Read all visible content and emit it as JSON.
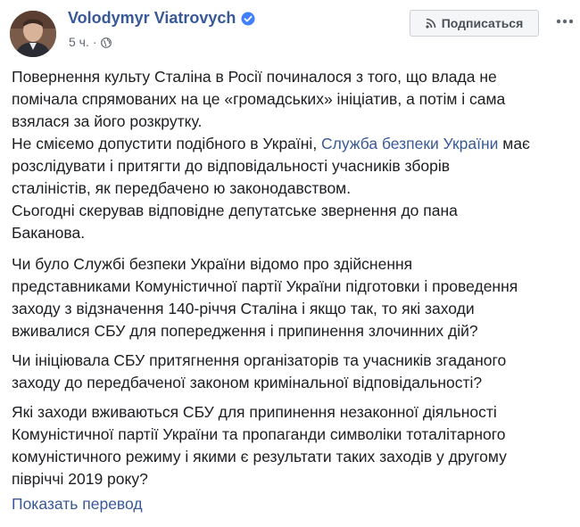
{
  "author": {
    "name": "Volodymyr Viatrovych",
    "verified": true
  },
  "meta": {
    "time": "5 ч.",
    "separator": "·",
    "privacy_icon": "globe-icon"
  },
  "actions": {
    "subscribe_label": "Подписаться",
    "subscribe_icon": "rss-icon",
    "more_icon": "more-icon"
  },
  "post": {
    "p1_line1": "Повернення культу Сталіна в Росії починалося з того, що влада не",
    "p1_line2": "помічала спрямованих на це «громадських» ініціатив, а потім і сама",
    "p1_line3": "взялася за його розкрутку.",
    "p1_line4": "Не смієемо допустити подібного в Україні, ",
    "p1_link": "Служба безпеки України",
    "p1_line4_tail": " має",
    "p1_line5": "розслідувати і притягти до відповідальності учасників зборів",
    "p1_line6": "сталіністів, як передбачено ю законодавством.",
    "p1_line7": "Сьогодні скерував відповідне депутатське звернення до пана",
    "p1_line8": "Баканова.",
    "p2_line1": "Чи було Службі безпеки України відомо про здійснення",
    "p2_line2": "представниками Комуністичної партії України підготовки і проведення",
    "p2_line3": "заходу з відзначення 140-річчя Сталіна і якщо так, то які заходи",
    "p2_line4": "вживалися СБУ для попередження і припинення злочинних дій?",
    "p3_line1": "Чи ініціювала СБУ притягнення організаторів та учасників згаданого",
    "p3_line2": "заходу до передбаченої законом кримінальної відповідальності?",
    "p4_line1": "Які заходи вживаються СБУ для припинення незаконної діяльності",
    "p4_line2": "Комуністичної партії України та пропаганди символіки тоталітарного",
    "p4_line3": "комуністичного режиму і якими є результати таких заходів у другому",
    "p4_line4": "півріччі 2019 року?"
  },
  "translate_label": "Показать перевод",
  "colors": {
    "link": "#385898",
    "text": "#1c1e21",
    "meta": "#616770",
    "verified": "#4080ff"
  }
}
